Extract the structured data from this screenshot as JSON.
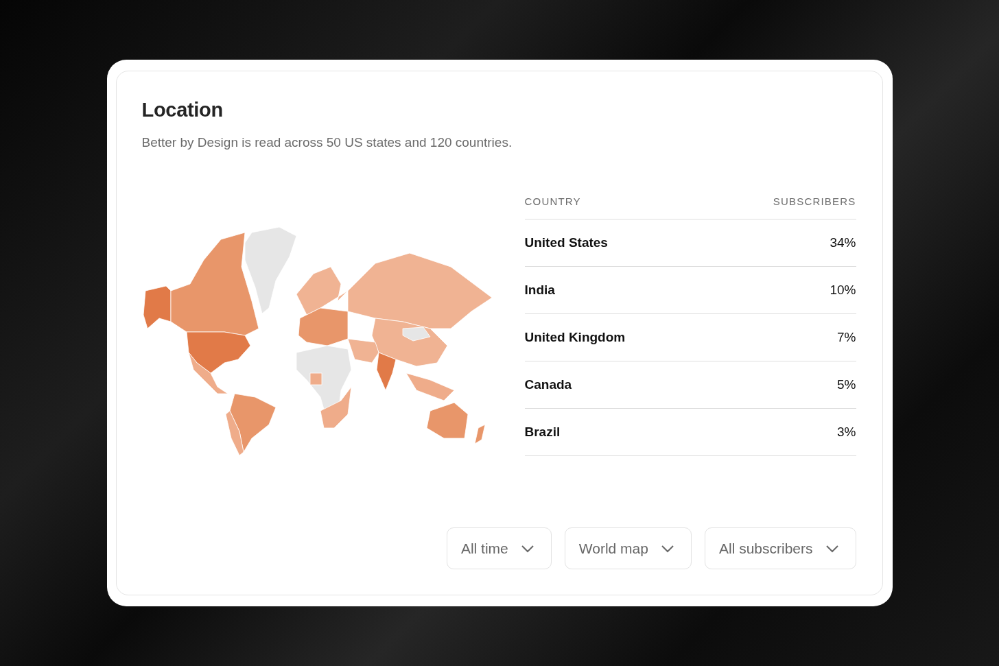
{
  "card": {
    "title": "Location",
    "subtitle": "Better by Design is read across 50 US states and 120 countries."
  },
  "table": {
    "columns": [
      "COUNTRY",
      "SUBSCRIBERS"
    ],
    "rows": [
      {
        "country": "United States",
        "share": "34%"
      },
      {
        "country": "India",
        "share": "10%"
      },
      {
        "country": "United Kingdom",
        "share": "7%"
      },
      {
        "country": "Canada",
        "share": "5%"
      },
      {
        "country": "Brazil",
        "share": "3%"
      }
    ]
  },
  "filters": [
    {
      "label": "All time"
    },
    {
      "label": "World map"
    },
    {
      "label": "All subscribers"
    }
  ]
}
